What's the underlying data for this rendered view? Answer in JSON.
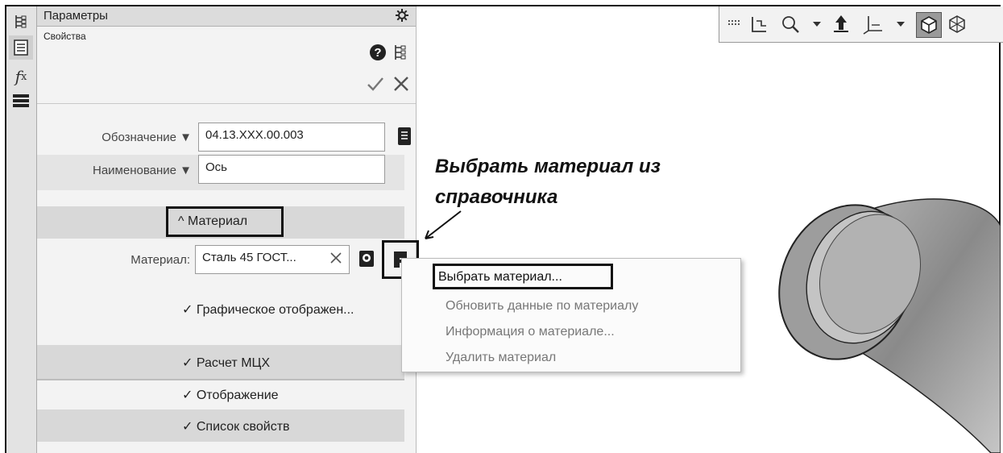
{
  "panel": {
    "title": "Параметры",
    "subtitle": "Свойства",
    "designation_label": "Обозначение ▼",
    "designation_value": "04.13.XXX.00.003",
    "name_label": "Наименование ▼",
    "name_value": "Ось",
    "material_section": "^ Материал",
    "material_label": "Материал:",
    "material_value": "Сталь 45  ГОСТ...",
    "sections": [
      "✓ Графическое отображен...",
      "✓ Расчет МЦХ",
      "✓ Отображение",
      "✓ Список свойств"
    ]
  },
  "annotation": "Выбрать материал из справочника",
  "context_menu": {
    "items": [
      {
        "label": "Выбрать материал...",
        "enabled": true
      },
      {
        "label": "Обновить данные по материалу",
        "enabled": false
      },
      {
        "label": "Информация о материале...",
        "enabled": false
      },
      {
        "label": "Удалить материал",
        "enabled": false
      }
    ]
  },
  "icons": {
    "left_toolbar": [
      "tree-icon",
      "properties-icon",
      "fx-icon",
      "menu-icon"
    ],
    "panel_header": [
      "gear-icon",
      "help-icon",
      "tree-icon",
      "check-icon",
      "close-icon"
    ],
    "top_toolbar": [
      "grid-icon",
      "sketch-icon",
      "zoom-icon",
      "dropdown-icon",
      "orient-icon",
      "axes-icon",
      "dropdown-icon",
      "shaded-view-icon",
      "wireframe-icon"
    ]
  },
  "colors": {
    "panel_bg": "#f3f3f3",
    "band_bg": "#d8d8d8",
    "highlight_border": "#111111",
    "disabled_text": "#777777"
  }
}
